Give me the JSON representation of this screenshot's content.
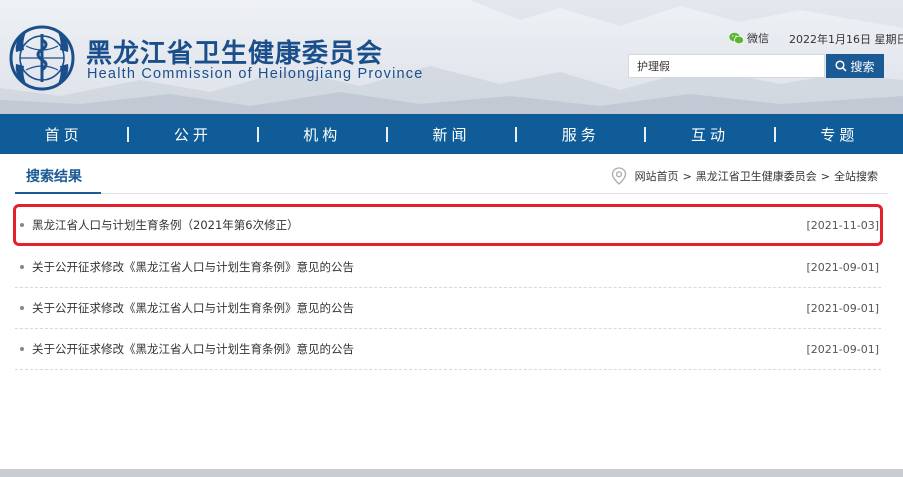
{
  "header": {
    "title_cn": "黑龙江省卫生健康委员会",
    "title_en": "Health  Commission  of  Heilongjiang  Province",
    "wechat_label": "微信",
    "date_text": "2022年1月16日 星期日",
    "search_value": "护理假",
    "search_button_label": "搜索",
    "icons": {
      "emblem": "who-emblem-icon",
      "wechat": "wechat-icon",
      "search": "search-icon"
    },
    "brand_color": "#1b5a94"
  },
  "nav": {
    "items": [
      {
        "label": "首页"
      },
      {
        "label": "公开"
      },
      {
        "label": "机构"
      },
      {
        "label": "新闻"
      },
      {
        "label": "服务"
      },
      {
        "label": "互动"
      },
      {
        "label": "专题"
      }
    ],
    "background": "#0f5c98"
  },
  "section": {
    "title": "搜索结果",
    "breadcrumb": {
      "home": "网站首页",
      "sep1": ">",
      "site": "黑龙江省卫生健康委员会",
      "sep2": ">",
      "current": "全站搜索"
    }
  },
  "results": [
    {
      "title": "黑龙江省人口与计划生育条例（2021年第6次修正）",
      "date": "[2021-11-03]",
      "highlighted": true
    },
    {
      "title": "关于公开征求修改《黑龙江省人口与计划生育条例》意见的公告",
      "date": "[2021-09-01]",
      "highlighted": false
    },
    {
      "title": "关于公开征求修改《黑龙江省人口与计划生育条例》意见的公告",
      "date": "[2021-09-01]",
      "highlighted": false
    },
    {
      "title": "关于公开征求修改《黑龙江省人口与计划生育条例》意见的公告",
      "date": "[2021-09-01]",
      "highlighted": false
    }
  ],
  "highlight_color": "#e4202a"
}
